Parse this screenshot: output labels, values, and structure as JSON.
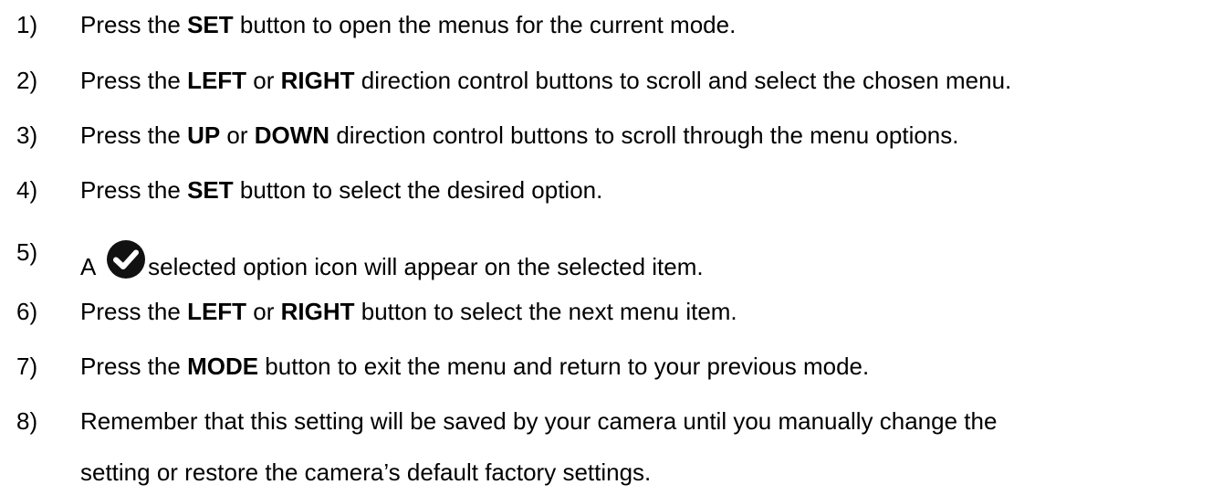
{
  "steps": [
    {
      "number": "1)",
      "parts": [
        "Press the ",
        "SET",
        " button to open the menus for the current mode."
      ]
    },
    {
      "number": "2)",
      "parts": [
        "Press the ",
        "LEFT",
        " or ",
        "RIGHT",
        " direction control buttons to scroll and select the chosen menu."
      ]
    },
    {
      "number": "3)",
      "parts": [
        "Press the ",
        "UP",
        " or ",
        "DOWN",
        " direction control buttons to scroll through the menu options."
      ]
    },
    {
      "number": "4)",
      "parts": [
        "Press the ",
        "SET",
        " button to select the desired option."
      ]
    },
    {
      "number": "5)",
      "parts": [
        "A ",
        "selected option icon will appear on the selected item."
      ],
      "icon": "check-circle-icon"
    },
    {
      "number": "6)",
      "parts": [
        "Press the ",
        "LEFT",
        " or ",
        "RIGHT",
        " button to select the next menu item."
      ]
    },
    {
      "number": "7)",
      "parts": [
        "Press the ",
        "MODE",
        " button to exit the menu and return to your previous mode."
      ]
    },
    {
      "number": "8)",
      "parts": [
        "Remember that this setting will be saved by your camera until you manually change the"
      ],
      "continuation": "setting or restore the camera’s default factory settings."
    }
  ]
}
